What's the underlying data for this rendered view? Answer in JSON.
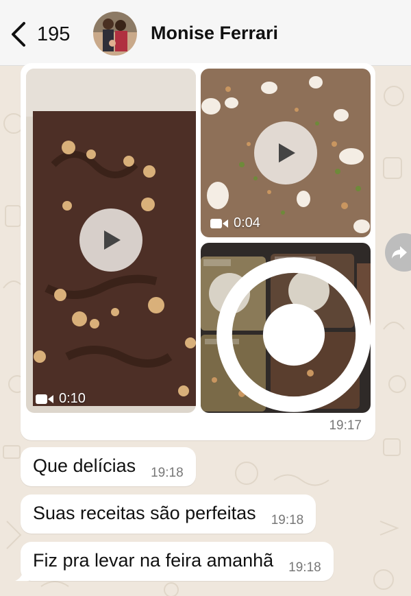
{
  "header": {
    "back_count": "195",
    "contact_name": "Monise Ferrari"
  },
  "media_message": {
    "videos": [
      {
        "duration": "0:10"
      },
      {
        "duration": "0:04"
      }
    ],
    "time": "19:17"
  },
  "messages": [
    {
      "text": "Que delícias",
      "time": "19:18"
    },
    {
      "text": "Suas receitas são perfeitas",
      "time": "19:18"
    },
    {
      "text": "Fiz pra levar na feira amanhã",
      "time": "19:18"
    }
  ],
  "colors": {
    "chat_background": "#efe7dd",
    "bubble": "#ffffff",
    "header": "#f6f6f6"
  }
}
